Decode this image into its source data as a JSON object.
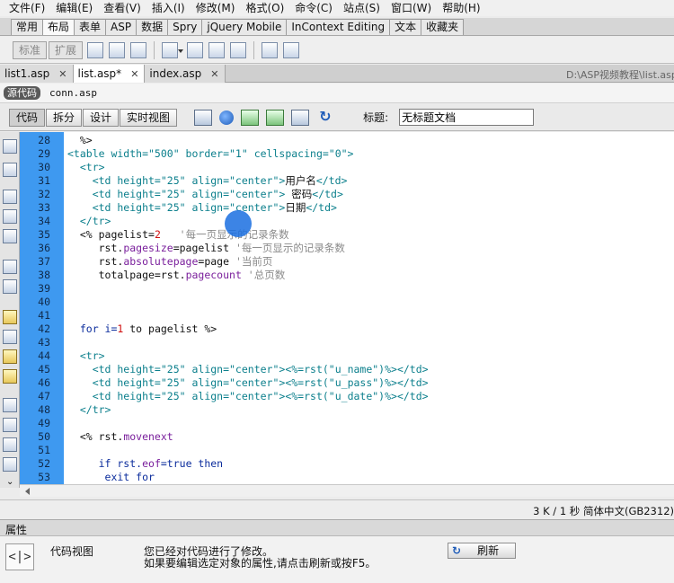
{
  "menu": [
    "文件(F)",
    "编辑(E)",
    "查看(V)",
    "插入(I)",
    "修改(M)",
    "格式(O)",
    "命令(C)",
    "站点(S)",
    "窗口(W)",
    "帮助(H)"
  ],
  "insert_tabs": [
    "常用",
    "布局",
    "表单",
    "ASP",
    "数据",
    "Spry",
    "jQuery Mobile",
    "InContext Editing",
    "文本",
    "收藏夹"
  ],
  "insert_modes": [
    "标准",
    "扩展"
  ],
  "doc_tabs": [
    {
      "label": "list1.asp",
      "close": "✕"
    },
    {
      "label": "list.asp*",
      "close": "✕"
    },
    {
      "label": "index.asp",
      "close": "✕"
    }
  ],
  "doc_path": "D:\\ASP视频教程\\list.asp",
  "related": {
    "source": "源代码",
    "file": "conn.asp"
  },
  "view_buttons": [
    "代码",
    "拆分",
    "设计",
    "实时视图"
  ],
  "title_label": "标题:",
  "title_value": "无标题文档",
  "line_numbers": [
    "28",
    "29",
    "30",
    "31",
    "32",
    "33",
    "34",
    "35",
    "36",
    "37",
    "38",
    "39",
    "40",
    "41",
    "42",
    "43",
    "44",
    "45",
    "46",
    "47",
    "48",
    "49",
    "50",
    "51",
    "52",
    "53"
  ],
  "code": {
    "l28": "  %>",
    "l29a": "<table width=\"500\" border=\"1\" cellspacing=\"0\">",
    "l30": "  <tr>",
    "l31a": "    <td height=\"25\" align=\"center\">",
    "l31b": "用户名",
    "l31c": "</td>",
    "l32a": "    <td height=\"25\" align=\"center\">",
    "l32b": " 密码",
    "l32c": "</td>",
    "l33a": "    <td height=\"25\" align=\"center\">",
    "l33b": "日期",
    "l33c": "</td>",
    "l34": "  </tr>",
    "l35a": "  <% pagelist=",
    "l35b": "2",
    "l35c": "   '每一页显示的记录条数",
    "l36a": "     rst.",
    "l36b": "pagesize",
    "l36c": "=pagelist ",
    "l36d": "'每一页显示的记录条数",
    "l37a": "     rst.",
    "l37b": "absolutepage",
    "l37c": "=page ",
    "l37d": "'当前页",
    "l38a": "     totalpage=rst.",
    "l38b": "pagecount",
    "l38c": " '总页数",
    "l42a": "  for i=",
    "l42b": "1",
    "l42c": " to pagelist %>",
    "l44": "  <tr>",
    "l45a": "    <td height=\"25\" align=\"center\">",
    "l45b": "<%=rst(\"u_name\")%>",
    "l45c": "</td>",
    "l46a": "    <td height=\"25\" align=\"center\">",
    "l46b": "<%=rst(\"u_pass\")%>",
    "l46c": "</td>",
    "l47a": "    <td height=\"25\" align=\"center\">",
    "l47b": "<%=rst(\"u_date\")%>",
    "l47c": "</td>",
    "l48": "  </tr>",
    "l50a": "  <% rst.",
    "l50b": "movenext",
    "l52a": "     if rst.",
    "l52b": "eof",
    "l52c": "=true then",
    "l53": "      exit for"
  },
  "status": "3 K / 1 秒  简体中文(GB2312)",
  "properties": {
    "header": "属性",
    "icon": "<|>",
    "view_label": "代码视图",
    "message1": "您已经对代码进行了修改。",
    "message2": "如果要编辑选定对象的属性,请点击刷新或按F5。",
    "refresh_icon": "↻",
    "refresh": "刷新"
  }
}
